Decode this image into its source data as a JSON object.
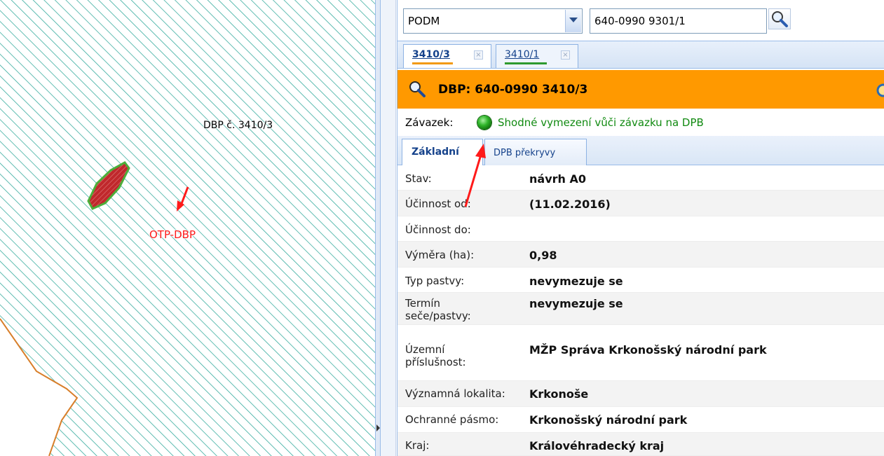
{
  "map": {
    "parcel_label": "DBP č. 3410/3",
    "overlay_label": "OTP-DBP",
    "colors": {
      "hatch": "#2ea89a",
      "boundary": "#d87f2a",
      "patch_fill": "#c0282c",
      "patch_edge": "#4cae3a",
      "arrow": "#ff1a1a"
    }
  },
  "search": {
    "type_value": "PODM",
    "query_value": "640-0990 9301/1"
  },
  "parcel_tabs": [
    {
      "label": "3410/3",
      "close": "×",
      "underline_color": "#f29a14"
    },
    {
      "label": "3410/1",
      "close": "×",
      "underline_color": "#2e9a2e"
    }
  ],
  "header": {
    "title": "DBP: 640-0990 3410/3",
    "background": "#ff9900"
  },
  "commitment": {
    "label": "Závazek:",
    "status_text": "Shodné vymezení vůči závazku na DPB",
    "status_color": "#118a11"
  },
  "detail_tabs": [
    {
      "label": "Základní"
    },
    {
      "label": "DPB překryvy"
    }
  ],
  "attributes": [
    {
      "label": "Stav:",
      "value": "návrh A0"
    },
    {
      "label": "Účinnost od:",
      "value": "(11.02.2016)"
    },
    {
      "label": "Účinnost do:",
      "value": ""
    },
    {
      "label": "Výměra (ha):",
      "value": "0,98"
    },
    {
      "label": "Typ pastvy:",
      "value": "nevymezuje se"
    },
    {
      "label": "Termín seče/pastvy:",
      "value": "nevymezuje se"
    },
    {
      "label": "Územní příslušnost:",
      "value": "MŽP Správa Krkonošský národní park"
    },
    {
      "label": "Významná lokalita:",
      "value": "Krkonoše"
    },
    {
      "label": "Ochranné pásmo:",
      "value": "Krkonošský národní park"
    },
    {
      "label": "Kraj:",
      "value": "Královéhradecký kraj"
    }
  ]
}
